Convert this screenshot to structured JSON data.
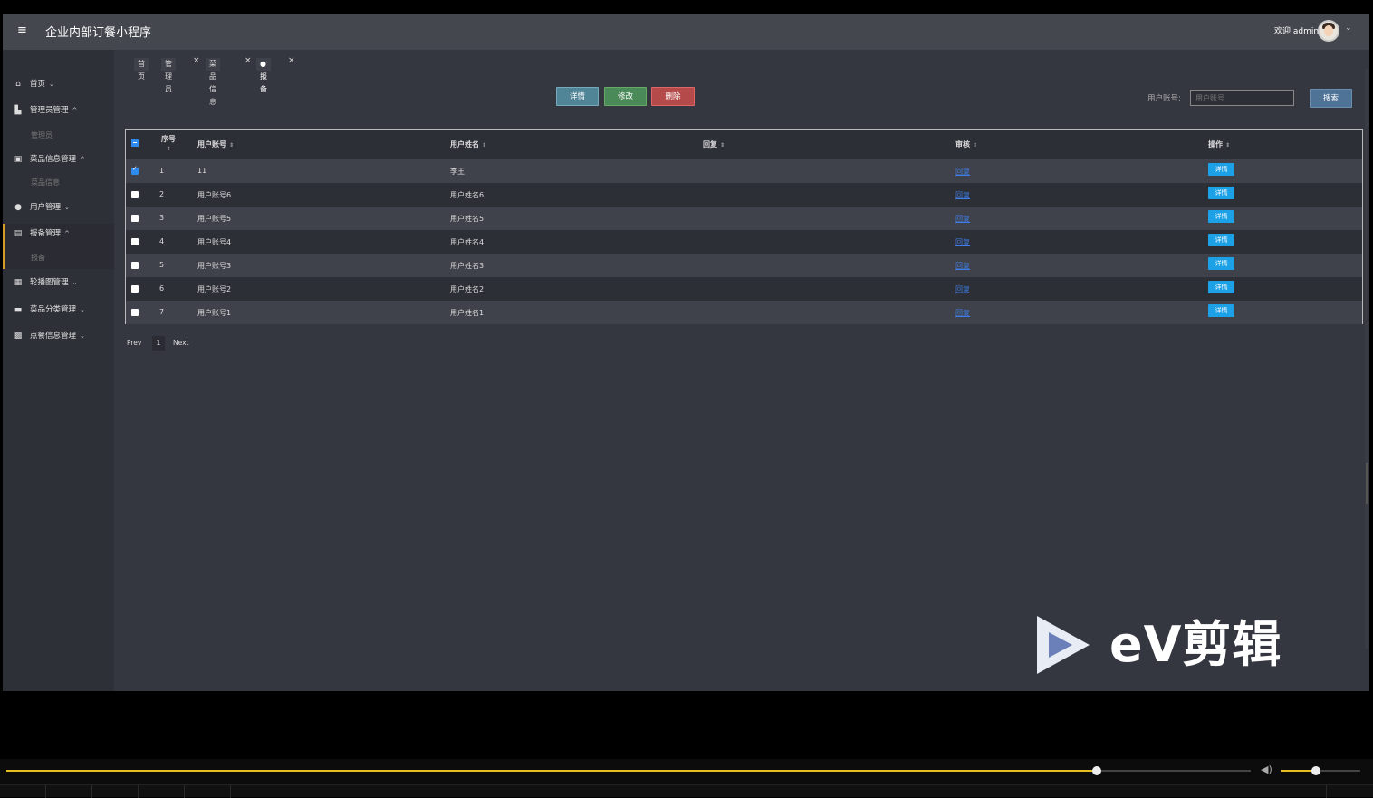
{
  "header": {
    "menu_glyph": "≡",
    "title": "企业内部订餐小程序",
    "welcome": "欢迎 admin",
    "caret": "⌄"
  },
  "sidebar": {
    "items": [
      {
        "icon": "home-icon",
        "glyph": "⌂",
        "label": "首页",
        "caret": "⌄"
      },
      {
        "icon": "admin-icon",
        "glyph": "▙",
        "label": "管理员管理",
        "caret": "^"
      },
      {
        "icon": "dish-icon",
        "glyph": "▣",
        "label": "菜品信息管理",
        "caret": "^"
      },
      {
        "icon": "user-icon",
        "glyph": "●",
        "label": "用户管理",
        "caret": "⌄"
      },
      {
        "icon": "report-icon",
        "glyph": "▤",
        "label": "报备管理",
        "caret": "^"
      },
      {
        "icon": "carousel-icon",
        "glyph": "▦",
        "label": "轮播图管理",
        "caret": "⌄"
      },
      {
        "icon": "category-icon",
        "glyph": "▬",
        "label": "菜品分类管理",
        "caret": "⌄"
      },
      {
        "icon": "order-icon",
        "glyph": "▩",
        "label": "点餐信息管理",
        "caret": "⌄"
      }
    ],
    "subs": [
      "管理员",
      "菜品信息",
      "报备"
    ]
  },
  "breadcrumbs": {
    "items": [
      "首页",
      "管理员",
      "菜品信息",
      "●报备"
    ],
    "close": "×"
  },
  "toolbar": {
    "detail_label": "详情",
    "edit_label": "修改",
    "delete_label": "删除",
    "search_label": "用户账号:",
    "search_placeholder": "用户账号",
    "search_button": "搜索"
  },
  "table": {
    "columns": [
      "序号",
      "用户账号",
      "用户姓名",
      "回复",
      "审核",
      "操作"
    ],
    "sort_glyph": "⇕",
    "rows": [
      {
        "checked": true,
        "index": "1",
        "account": "11",
        "name": "李王",
        "reply": "",
        "audit": "回复",
        "action": "详情"
      },
      {
        "checked": false,
        "index": "2",
        "account": "用户账号6",
        "name": "用户姓名6",
        "reply": "",
        "audit": "回复",
        "action": "详情"
      },
      {
        "checked": false,
        "index": "3",
        "account": "用户账号5",
        "name": "用户姓名5",
        "reply": "",
        "audit": "回复",
        "action": "详情"
      },
      {
        "checked": false,
        "index": "4",
        "account": "用户账号4",
        "name": "用户姓名4",
        "reply": "",
        "audit": "回复",
        "action": "详情"
      },
      {
        "checked": false,
        "index": "5",
        "account": "用户账号3",
        "name": "用户姓名3",
        "reply": "",
        "audit": "回复",
        "action": "详情"
      },
      {
        "checked": false,
        "index": "6",
        "account": "用户账号2",
        "name": "用户姓名2",
        "reply": "",
        "audit": "回复",
        "action": "详情"
      },
      {
        "checked": false,
        "index": "7",
        "account": "用户账号1",
        "name": "用户姓名1",
        "reply": "",
        "audit": "回复",
        "action": "详情"
      }
    ]
  },
  "pager": {
    "prev": "Prev",
    "current": "1",
    "next": "Next"
  },
  "watermark": {
    "text": "eV剪辑"
  },
  "player": {
    "progress": 0.876,
    "volume": 0.44,
    "volume_glyph": "◀)"
  },
  "colors": {
    "accent_blue": "#1ca0e6",
    "link_blue": "#3f7ee6",
    "active_border": "#d39b2a",
    "progress_yellow": "#e6c020"
  }
}
